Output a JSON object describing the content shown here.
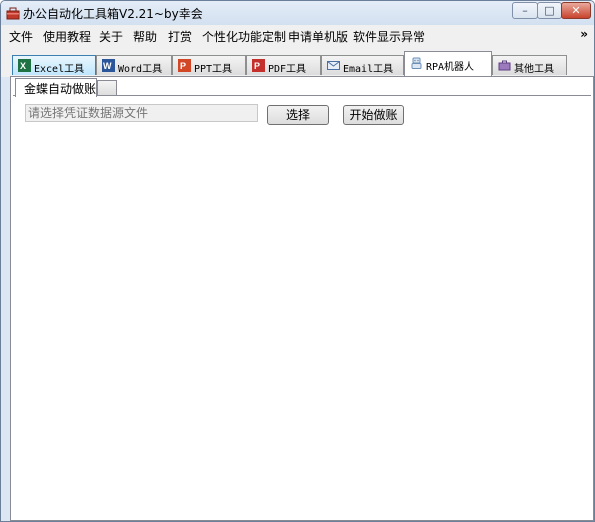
{
  "window": {
    "title": "办公自动化工具箱V2.21~by幸会",
    "controls": {
      "minimize": "–",
      "maximize": "□",
      "close": "✕"
    }
  },
  "menu": {
    "items": [
      "文件",
      "使用教程",
      "关于",
      "帮助",
      "打赏",
      "个性化功能定制",
      "申请单机版",
      "软件显示异常"
    ],
    "overflow": "»"
  },
  "tabs": [
    {
      "label": "Excel工具",
      "icon": "excel-icon",
      "color": "#1f7244"
    },
    {
      "label": "Word工具",
      "icon": "word-icon",
      "color": "#2b579a"
    },
    {
      "label": "PPT工具",
      "icon": "ppt-icon",
      "color": "#d24726"
    },
    {
      "label": "PDF工具",
      "icon": "pdf-icon",
      "color": "#c4302b"
    },
    {
      "label": "Email工具",
      "icon": "email-icon",
      "color": "#4a6fa5"
    },
    {
      "label": "RPA机器人",
      "icon": "robot-icon",
      "color": "#6a8fb5",
      "selected": true
    },
    {
      "label": "其他工具",
      "icon": "briefcase-icon",
      "color": "#7a5a9c"
    }
  ],
  "subtabs": {
    "active": "金蝶自动做账"
  },
  "form": {
    "path_placeholder": "请选择凭证数据源文件",
    "choose_label": "选择",
    "start_label": "开始做账"
  }
}
